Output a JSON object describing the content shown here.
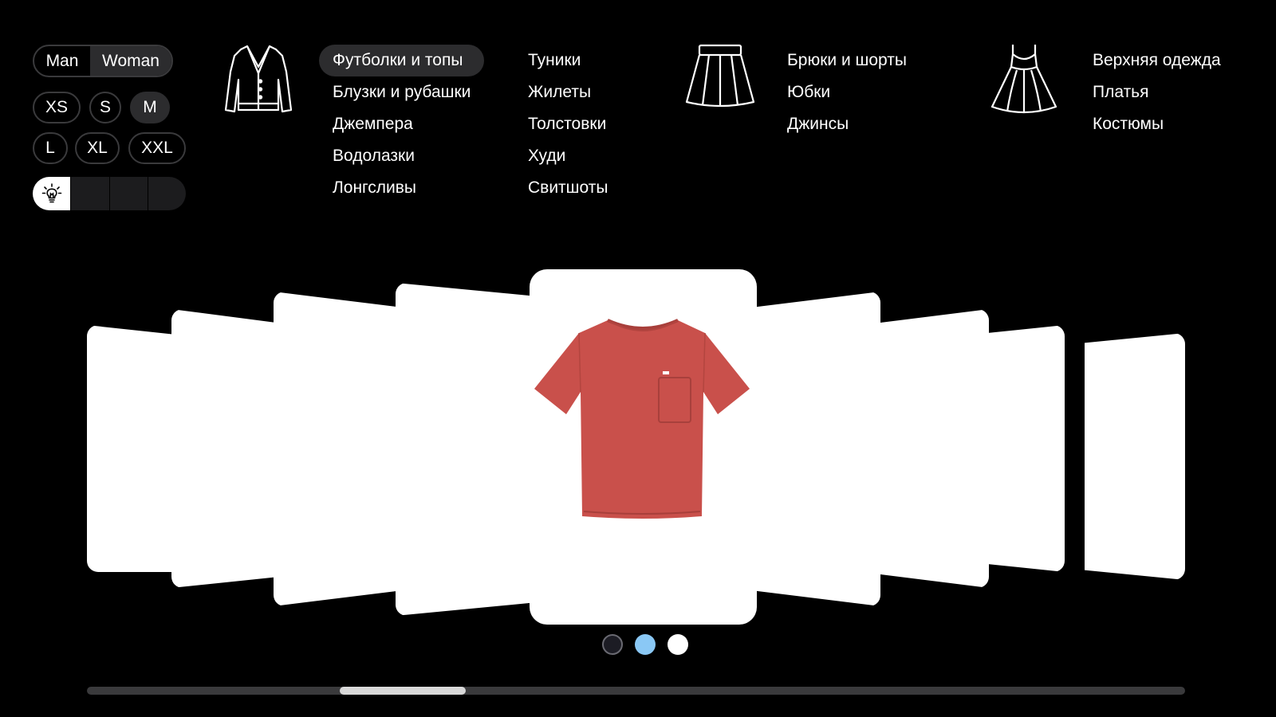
{
  "gender": {
    "options": [
      "Man",
      "Woman"
    ],
    "selected": "Woman"
  },
  "sizes": [
    {
      "label": "XS",
      "selected": false
    },
    {
      "label": "S",
      "selected": false
    },
    {
      "label": "M",
      "selected": true
    },
    {
      "label": "L",
      "selected": false
    },
    {
      "label": "XL",
      "selected": false
    },
    {
      "label": "XXL",
      "selected": false
    }
  ],
  "lighting": {
    "icon": "lightbulb-icon",
    "selected_index": 0
  },
  "categories": {
    "tops": {
      "icon": "cardigan-icon",
      "col1": [
        "Футболки и топы",
        "Блузки и рубашки",
        "Джемпера",
        "Водолазки",
        "Лонгсливы"
      ],
      "col2": [
        "Туники",
        "Жилеты",
        "Толстовки",
        "Худи",
        "Свитшоты"
      ],
      "selected": "Футболки и топы"
    },
    "bottoms": {
      "icon": "skirt-icon",
      "items": [
        "Брюки и шорты",
        "Юбки",
        "Джинсы"
      ]
    },
    "dresses": {
      "icon": "dress-icon",
      "items": [
        "Верхняя одежда",
        "Платья",
        "Костюмы"
      ]
    }
  },
  "carousel": {
    "current_item": "red-tshirt",
    "product_color": "#c9504b"
  },
  "color_swatches": [
    {
      "color": "#1c1c24",
      "selected": false
    },
    {
      "color": "#8ac8f5",
      "selected": true
    },
    {
      "color": "#ffffff",
      "selected": false
    }
  ],
  "scrollbar": {
    "position": 0.23,
    "visible_fraction": 0.115
  }
}
